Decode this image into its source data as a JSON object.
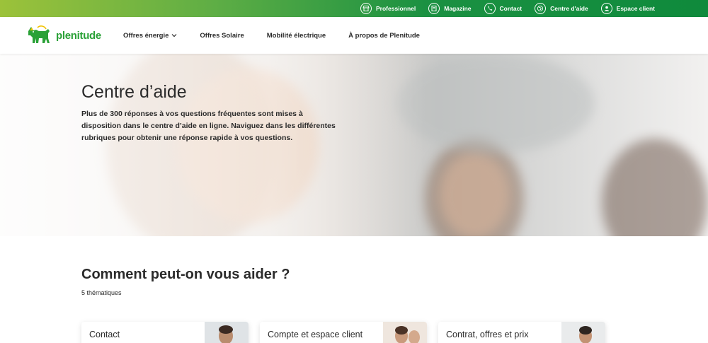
{
  "topbar": {
    "items": [
      {
        "label": "Professionnel",
        "icon": "store-icon"
      },
      {
        "label": "Magazine",
        "icon": "book-icon"
      },
      {
        "label": "Contact",
        "icon": "phone-icon"
      },
      {
        "label": "Centre d'aide",
        "icon": "globe-icon"
      },
      {
        "label": "Espace client",
        "icon": "user-icon"
      }
    ]
  },
  "header": {
    "logo_text": "plenitude",
    "nav": [
      {
        "label": "Offres énergie"
      },
      {
        "label": "Offres Solaire"
      },
      {
        "label": "Mobilité électrique"
      },
      {
        "label": "À propos de Plenitude"
      }
    ]
  },
  "hero": {
    "title": "Centre d’aide",
    "text": "Plus de 300 réponses à vos questions fréquentes sont mises à disposition dans le centre d’aide en ligne. Naviguez dans les différentes rubriques pour obtenir une réponse rapide à vos questions."
  },
  "section": {
    "title": "Comment peut-on vous aider ?",
    "count": "5 thématiques"
  },
  "cards": [
    {
      "label": "Contact"
    },
    {
      "label": "Compte et espace client"
    },
    {
      "label": "Contrat, offres et prix"
    }
  ],
  "colors": {
    "brand_green": "#0f8a3c",
    "logo_green": "#2aa137",
    "logo_yellow": "#f2c200"
  }
}
